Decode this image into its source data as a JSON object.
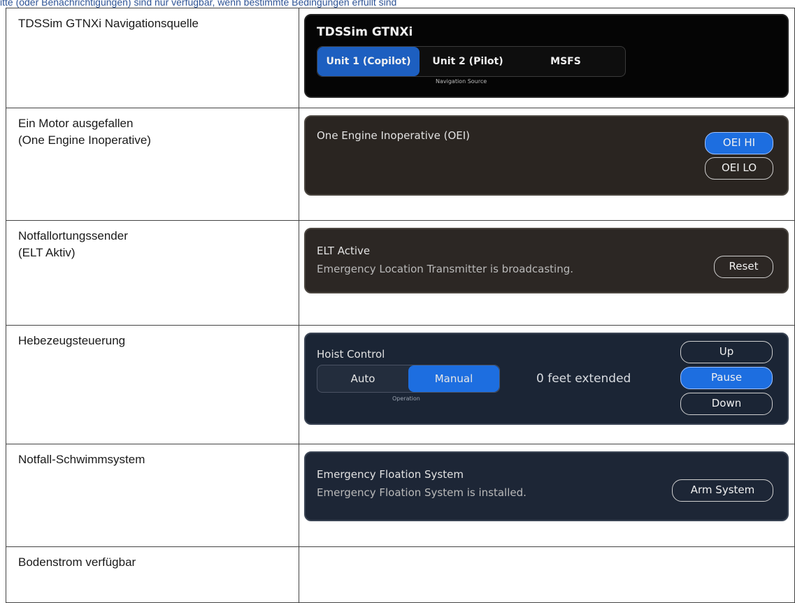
{
  "top_note": "itte (oder Benachrichtigungen) sind nur verfügbar, wenn bestimmte Bedingungen erfüllt sind",
  "rows": [
    {
      "label": "TDSSim GTNXi Navigationsquelle",
      "panel": {
        "title": "TDSSim GTNXi",
        "segments": [
          "Unit 1 (Copilot)",
          "Unit 2 (Pilot)",
          "MSFS"
        ],
        "active": "Unit 1 (Copilot)",
        "caption": "Navigation Source"
      }
    },
    {
      "label": "Ein Motor ausgefallen\n(One Engine Inoperative)",
      "panel": {
        "title": "One Engine Inoperative (OEI)",
        "buttons": [
          "OEI HI",
          "OEI LO"
        ],
        "active": "OEI HI"
      }
    },
    {
      "label": "Notfallortungssender\n(ELT Aktiv)",
      "panel": {
        "title": "ELT Active",
        "message": "Emergency Location Transmitter is broadcasting.",
        "button": "Reset"
      }
    },
    {
      "label": "Hebezeugsteuerung",
      "panel": {
        "title": "Hoist Control",
        "segments": [
          "Auto",
          "Manual"
        ],
        "active": "Manual",
        "caption": "Operation",
        "status": "0 feet extended",
        "buttons": [
          "Up",
          "Pause",
          "Down"
        ],
        "active_button": "Pause"
      }
    },
    {
      "label": "Notfall-Schwimmsystem",
      "panel": {
        "title": "Emergency Floation System",
        "message": "Emergency Floation System is installed.",
        "button": "Arm System"
      }
    },
    {
      "label": "Bodenstrom verfügbar"
    }
  ],
  "colors": {
    "accent_blue": "#1d6ee0",
    "gtn_active": "#1d5fc0",
    "note_text": "#2f5496"
  }
}
